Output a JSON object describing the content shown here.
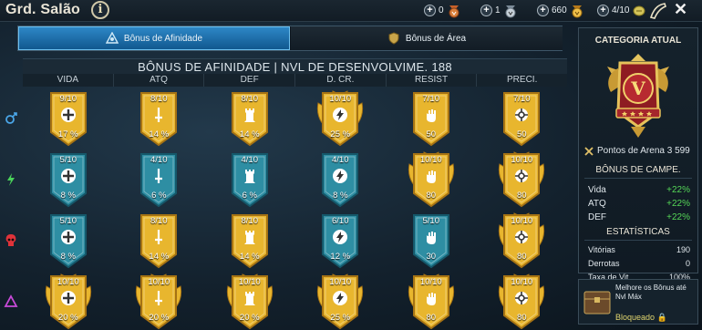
{
  "header": {
    "title": "Grd. Salão",
    "resources": [
      {
        "value": "0",
        "icon": "bronze-medal-icon"
      },
      {
        "value": "1",
        "icon": "silver-medal-icon"
      },
      {
        "value": "660",
        "icon": "gold-medal-icon"
      },
      {
        "value": "4/10",
        "icon": "arena-token-icon"
      }
    ]
  },
  "tabs": [
    {
      "label": "Bônus de Afinidade",
      "active": true
    },
    {
      "label": "Bônus de Área",
      "active": false
    }
  ],
  "grid": {
    "title": "BÔNUS DE AFINIDADE | NVL DE DESENVOLVIME. 188",
    "columns": [
      "VIDA",
      "ATQ",
      "DEF",
      "D. CR.",
      "RESIST",
      "PRECI."
    ],
    "rows": [
      {
        "affinity": "magic",
        "cells": [
          {
            "level": "9/10",
            "value": "17 %",
            "tier": "gold"
          },
          {
            "level": "8/10",
            "value": "14 %",
            "tier": "gold"
          },
          {
            "level": "8/10",
            "value": "14 %",
            "tier": "gold"
          },
          {
            "level": "10/10",
            "value": "25 %",
            "tier": "gold-max"
          },
          {
            "level": "7/10",
            "value": "50",
            "tier": "gold"
          },
          {
            "level": "7/10",
            "value": "50",
            "tier": "gold"
          }
        ]
      },
      {
        "affinity": "spirit",
        "cells": [
          {
            "level": "5/10",
            "value": "8 %",
            "tier": "blue"
          },
          {
            "level": "4/10",
            "value": "6 %",
            "tier": "blue"
          },
          {
            "level": "4/10",
            "value": "6 %",
            "tier": "blue"
          },
          {
            "level": "4/10",
            "value": "8 %",
            "tier": "blue"
          },
          {
            "level": "10/10",
            "value": "80",
            "tier": "gold-max"
          },
          {
            "level": "10/10",
            "value": "80",
            "tier": "gold-max"
          }
        ]
      },
      {
        "affinity": "force",
        "cells": [
          {
            "level": "5/10",
            "value": "8 %",
            "tier": "blue"
          },
          {
            "level": "8/10",
            "value": "14 %",
            "tier": "gold"
          },
          {
            "level": "8/10",
            "value": "14 %",
            "tier": "gold"
          },
          {
            "level": "6/10",
            "value": "12 %",
            "tier": "blue"
          },
          {
            "level": "5/10",
            "value": "30",
            "tier": "blue"
          },
          {
            "level": "10/10",
            "value": "80",
            "tier": "gold-max"
          }
        ]
      },
      {
        "affinity": "void",
        "cells": [
          {
            "level": "10/10",
            "value": "20 %",
            "tier": "gold-max"
          },
          {
            "level": "10/10",
            "value": "20 %",
            "tier": "gold-max"
          },
          {
            "level": "10/10",
            "value": "20 %",
            "tier": "gold-max"
          },
          {
            "level": "10/10",
            "value": "25 %",
            "tier": "gold-max"
          },
          {
            "level": "10/10",
            "value": "80",
            "tier": "gold-max"
          },
          {
            "level": "10/10",
            "value": "80",
            "tier": "gold-max"
          }
        ]
      }
    ]
  },
  "panel": {
    "title": "CATEGORIA ATUAL",
    "emblem_letter": "V",
    "arena_points": "Pontos de Arena 3 599",
    "champion_bonus_title": "BÔNUS DE CAMPE.",
    "champion_bonus": [
      {
        "label": "Vida",
        "value": "+22%"
      },
      {
        "label": "ATQ",
        "value": "+22%"
      },
      {
        "label": "DEF",
        "value": "+22%"
      }
    ],
    "stats_title": "ESTATÍSTICAS",
    "stats": [
      {
        "label": "Vitórias",
        "value": "190"
      },
      {
        "label": "Derrotas",
        "value": "0"
      },
      {
        "label": "Taxa de Vit.",
        "value": "100%"
      }
    ]
  },
  "promo": {
    "text": "Melhore os Bônus até Nvl Máx",
    "status": "Bloqueado"
  },
  "colors": {
    "gold": "#e8b62e",
    "gold_dark": "#a57214",
    "blue": "#2e8ea3",
    "blue_dark": "#15586a",
    "green": "#55d657"
  }
}
